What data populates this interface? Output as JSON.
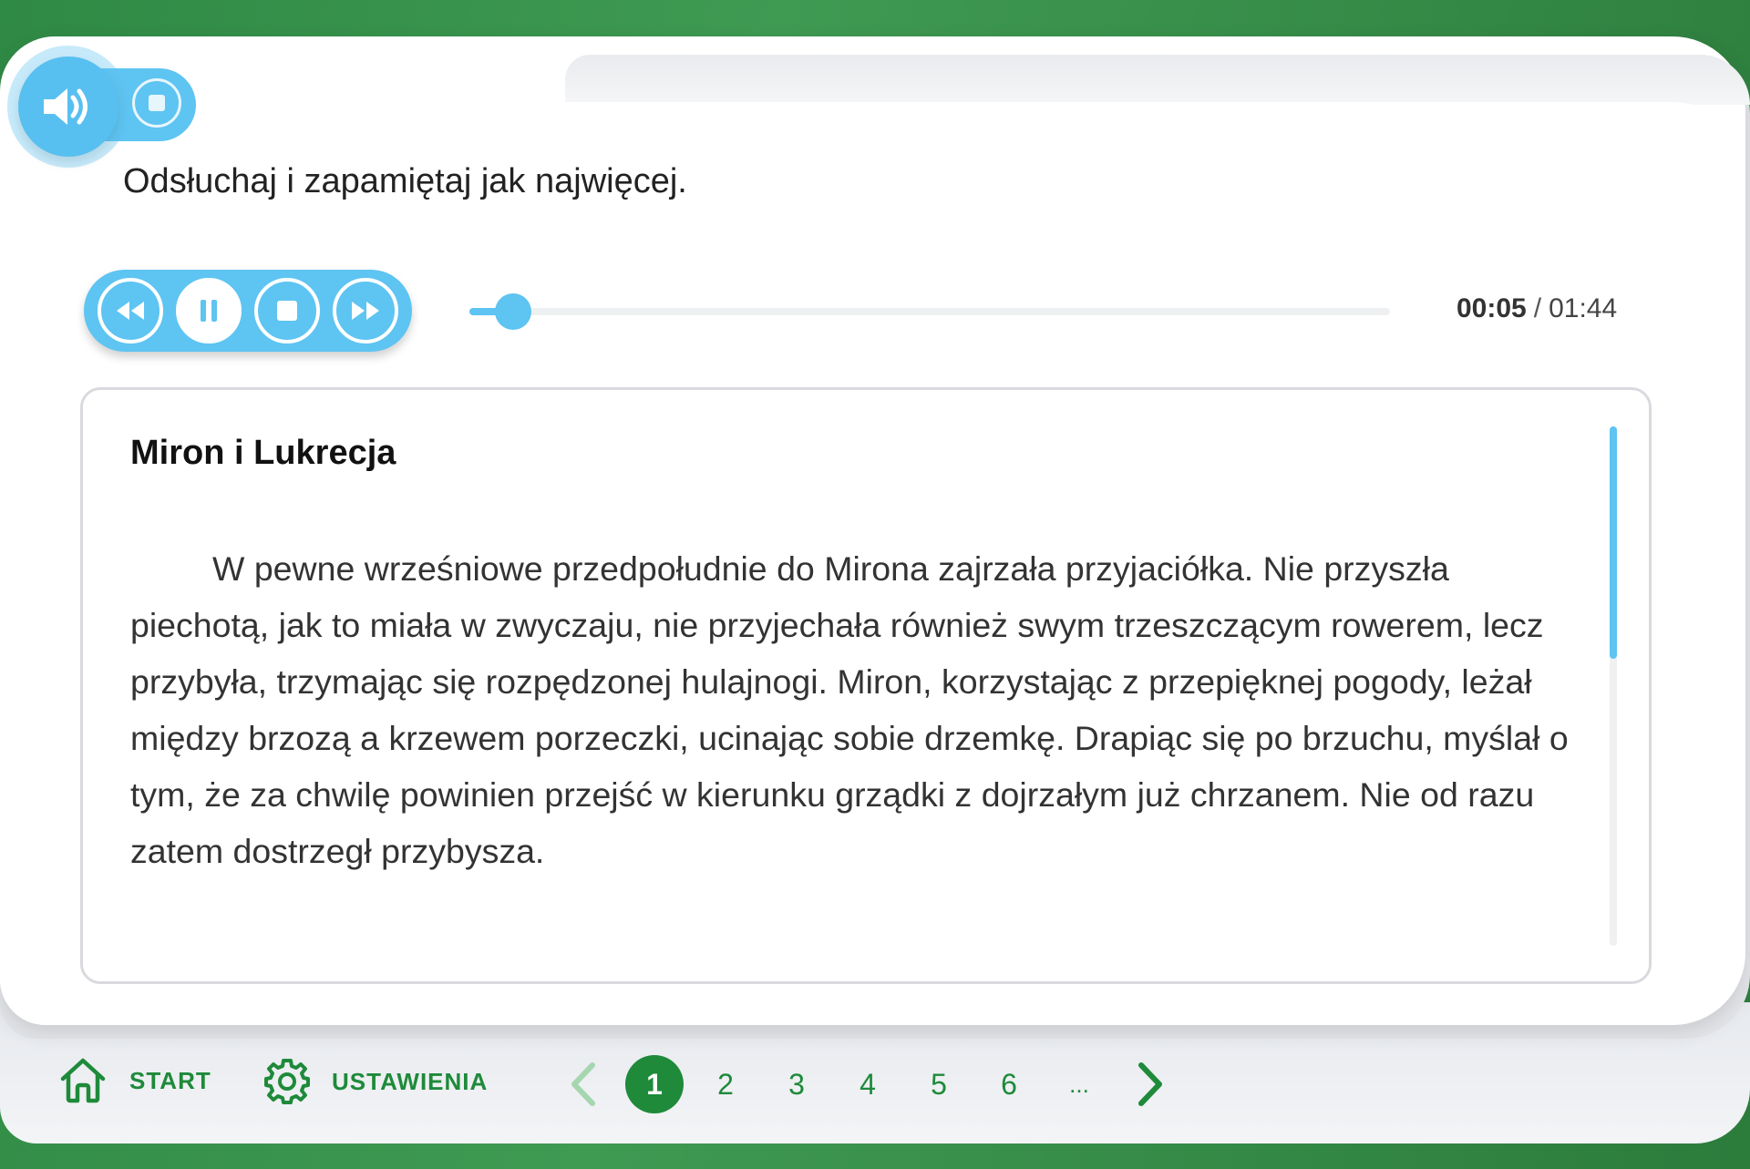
{
  "instruction": "Odsłuchaj i zapamiętaj jak najwięcej.",
  "audio_toggle": {
    "speaker_icon": "speaker-icon",
    "stop_icon": "stop-icon"
  },
  "player": {
    "buttons": [
      "rewind",
      "pause",
      "stop",
      "fast-forward"
    ],
    "progress": 0.048,
    "current_time": "00:05",
    "separator": "/",
    "total_time": "01:44"
  },
  "story": {
    "title": "Miron i Lukrecja",
    "text": "W pewne wrześniowe przedpołudnie do Mirona zajrzała przyjaciółka. Nie przyszła piechotą, jak to miała w zwyczaju, nie przyjechała również swym trzeszczącym rowerem, lecz przybyła, trzymając się rozpędzonej hulajnogi. Miron, korzystając z przepięknej pogody, leżał między brzozą a krzewem porzeczki, ucinając sobie drzemkę. Drapiąc się po brzuchu, myślał o tym, że za chwilę powinien przejść w kierunku grządki z dojrzałym już chrzanem. Nie od razu zatem dostrzegł przybysza.",
    "scroll_position": 0.0
  },
  "nav": {
    "start_label": "START",
    "settings_label": "USTAWIENIA",
    "pages": [
      "1",
      "2",
      "3",
      "4",
      "5",
      "6",
      "..."
    ],
    "current_page": "1"
  },
  "colors": {
    "accent_blue": "#5ec4f2",
    "accent_green": "#1e8a3a"
  }
}
